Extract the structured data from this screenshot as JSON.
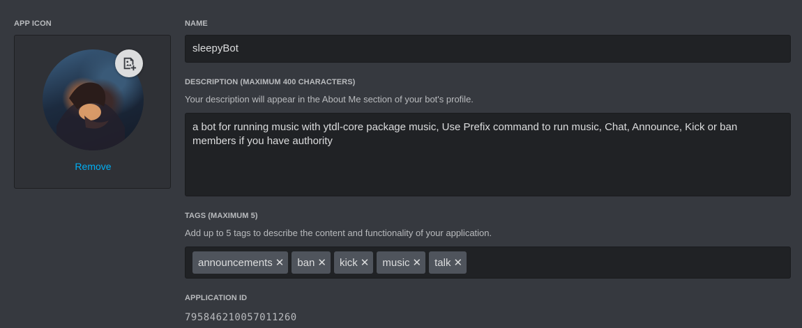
{
  "app_icon": {
    "label": "APP ICON",
    "remove_label": "Remove"
  },
  "name": {
    "label": "NAME",
    "value": "sleepyBot"
  },
  "description": {
    "label": "DESCRIPTION (MAXIMUM 400 CHARACTERS)",
    "hint": "Your description will appear in the About Me section of your bot's profile.",
    "value": "a bot for running music with ytdl-core package music, Use Prefix command to run music, Chat, Announce, Kick or ban members if you have authority"
  },
  "tags": {
    "label": "TAGS (MAXIMUM 5)",
    "hint": "Add up to 5 tags to describe the content and functionality of your application.",
    "items": [
      "announcements",
      "ban",
      "kick",
      "music",
      "talk"
    ],
    "remove_glyph": "✕"
  },
  "application_id": {
    "label": "APPLICATION ID",
    "value": "795846210057011260"
  },
  "icons": {
    "edit_avatar": "add-image-icon",
    "remove_tag": "close-icon"
  },
  "colors": {
    "background": "#36393f",
    "input_bg": "#202225",
    "link": "#00aff4",
    "tag_bg": "#4f545c"
  }
}
